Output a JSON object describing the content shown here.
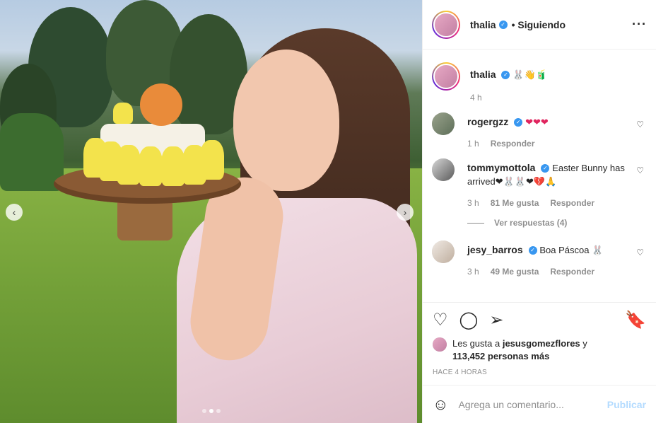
{
  "header": {
    "username": "thalia",
    "follow_status": "• Siguiendo",
    "more_icon": "ellipsis-icon"
  },
  "caption": {
    "username": "thalia",
    "text": "🐰👋🧃",
    "time": "4 h"
  },
  "comments": [
    {
      "username": "rogergzz",
      "text": "❤❤❤",
      "time": "1 h",
      "likes": "",
      "reply_label": "Responder"
    },
    {
      "username": "tommymottola",
      "text": "Easter Bunny has arrived❤🐰🐰❤💔🙏",
      "time": "3 h",
      "likes": "81 Me gusta",
      "reply_label": "Responder"
    },
    {
      "username": "jesy_barros",
      "text": "Boa Páscoa 🐰",
      "time": "3 h",
      "likes": "49 Me gusta",
      "reply_label": "Responder"
    }
  ],
  "view_replies": "Ver respuestas (4)",
  "likes_line": {
    "prefix": "Les gusta a",
    "user": "jesusgomezflores",
    "suffix": "y",
    "count": "113,452 personas más"
  },
  "posted": "HACE 4 HORAS",
  "add_comment": {
    "placeholder": "Agrega un comentario...",
    "post_label": "Publicar"
  },
  "nav": {
    "prev": "‹",
    "next": "›"
  },
  "colors": {
    "verified": "#3897f0",
    "publish_disabled": "#b3dbff",
    "muted": "#8e8e8e"
  }
}
